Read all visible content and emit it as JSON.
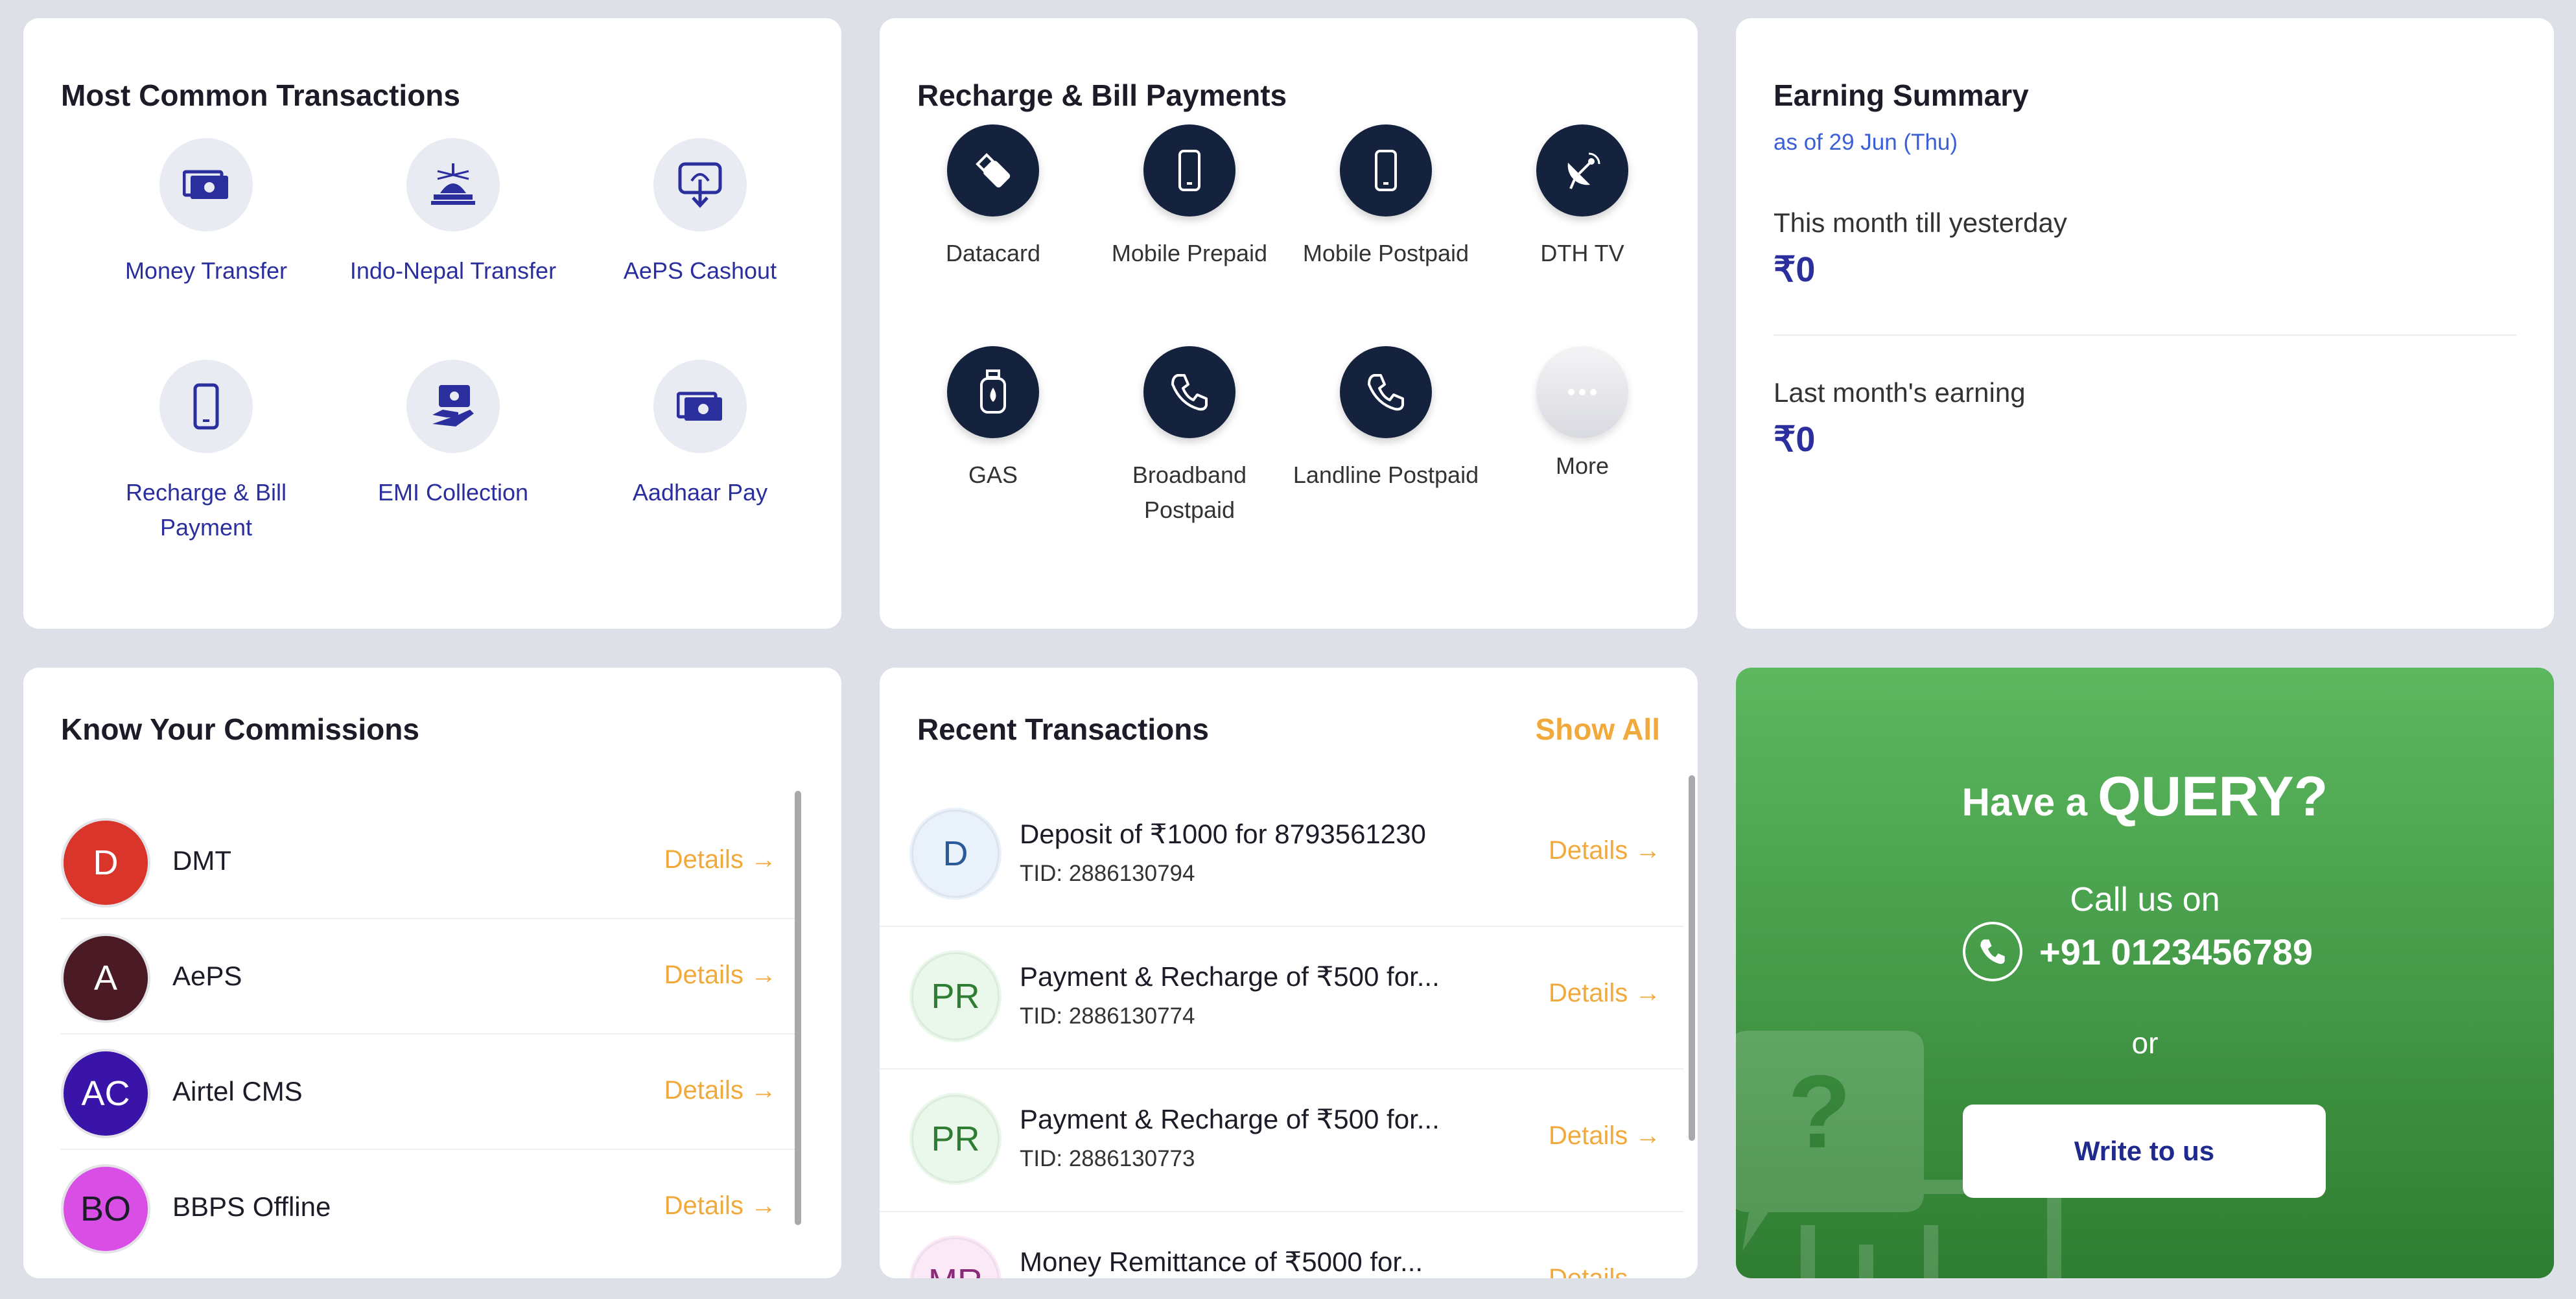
{
  "most_common": {
    "title": "Most Common Transactions",
    "items": [
      {
        "label": "Money Transfer",
        "icon": "money-transfer-icon"
      },
      {
        "label": "Indo-Nepal Transfer",
        "icon": "stupa-icon"
      },
      {
        "label": "AePS Cashout",
        "icon": "fingerprint-cashout-icon"
      },
      {
        "label": "Recharge & Bill Payment",
        "icon": "mobile-icon"
      },
      {
        "label": "EMI Collection",
        "icon": "emi-hand-icon"
      },
      {
        "label": "Aadhaar Pay",
        "icon": "cash-icon"
      }
    ]
  },
  "recharge": {
    "title": "Recharge & Bill Payments",
    "items": [
      {
        "label": "Datacard",
        "icon": "usb-stick-icon"
      },
      {
        "label": "Mobile Prepaid",
        "icon": "mobile-icon"
      },
      {
        "label": "Mobile Postpaid",
        "icon": "mobile-icon"
      },
      {
        "label": "DTH TV",
        "icon": "satellite-dish-icon"
      },
      {
        "label": "GAS",
        "icon": "gas-cylinder-icon"
      },
      {
        "label": "Broadband Postpaid",
        "icon": "phone-icon"
      },
      {
        "label": "Landline Postpaid",
        "icon": "phone-icon"
      },
      {
        "label": "More",
        "icon": "more-dots-icon"
      }
    ]
  },
  "earning": {
    "title": "Earning Summary",
    "as_of": "as of 29 Jun (Thu)",
    "month_label": "This month till yesterday",
    "month_value": "₹0",
    "last_label": "Last month's earning",
    "last_value": "₹0"
  },
  "commissions": {
    "title": "Know Your Commissions",
    "details_label": "Details →",
    "items": [
      {
        "initials": "D",
        "name": "DMT",
        "color": "#d9352a"
      },
      {
        "initials": "A",
        "name": "AePS",
        "color": "#4a1a25"
      },
      {
        "initials": "AC",
        "name": "Airtel CMS",
        "color": "#3a14a8"
      },
      {
        "initials": "BO",
        "name": "BBPS Offline",
        "color": "#d94fe6"
      }
    ]
  },
  "recent": {
    "title": "Recent Transactions",
    "show_all": "Show All",
    "details_label": "Details →",
    "items": [
      {
        "initials": "D",
        "title": "Deposit of ₹1000 for 8793561230",
        "tid": "TID: 2886130794",
        "bg": "#e9f1fb",
        "fg": "#2a5a9a"
      },
      {
        "initials": "PR",
        "title": "Payment & Recharge of ₹500 for...",
        "tid": "TID: 2886130774",
        "bg": "#e9f8ea",
        "fg": "#2f7d32"
      },
      {
        "initials": "PR",
        "title": "Payment & Recharge of ₹500 for...",
        "tid": "TID: 2886130773",
        "bg": "#e9f8ea",
        "fg": "#2f7d32"
      },
      {
        "initials": "MR",
        "title": "Money Remittance of ₹5000 for...",
        "tid": "",
        "bg": "#fbe9f7",
        "fg": "#8a2a7a"
      }
    ]
  },
  "query": {
    "have_a": "Have a",
    "query": "QUERY?",
    "call_us": "Call us on",
    "phone": "+91 0123456789",
    "or": "or",
    "write": "Write to us"
  },
  "colors": {
    "accent": "#2b2f9e",
    "orange": "#f2a93b",
    "navy": "#15223d",
    "green": "#4caf50"
  }
}
